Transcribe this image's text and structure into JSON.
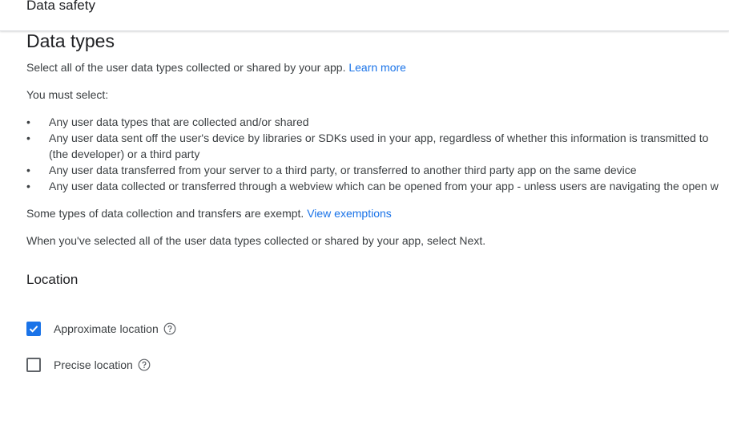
{
  "header": {
    "title": "Data safety"
  },
  "main": {
    "title": "Data types",
    "intro": {
      "text": "Select all of the user data types collected or shared by your app. ",
      "link": "Learn more"
    },
    "must_select": "You must select:",
    "bullets": [
      {
        "line1": "Any user data types that are collected and/or shared"
      },
      {
        "line1": "Any user data sent off the user's device by libraries or SDKs used in your app, regardless of whether this information is transmitted to",
        "line2": "(the developer) or a third party"
      },
      {
        "line1": "Any user data transferred from your server to a third party, or transferred to another third party app on the same device"
      },
      {
        "line1": "Any user data collected or transferred through a webview which can be opened from your app - unless users are navigating the open w"
      }
    ],
    "exempt": {
      "text": "Some types of data collection and transfers are exempt. ",
      "link": "View exemptions"
    },
    "next_note": "When you've selected all of the user data types collected or shared by your app, select Next."
  },
  "location": {
    "title": "Location",
    "options": [
      {
        "label": "Approximate location",
        "checked": true
      },
      {
        "label": "Precise location",
        "checked": false
      }
    ]
  },
  "colors": {
    "accent": "#1a73e8",
    "text": "#3c4043",
    "heading": "#202124"
  },
  "icons": {
    "bullet": "•",
    "help": "help-circle-icon",
    "check": "checkmark-icon"
  }
}
